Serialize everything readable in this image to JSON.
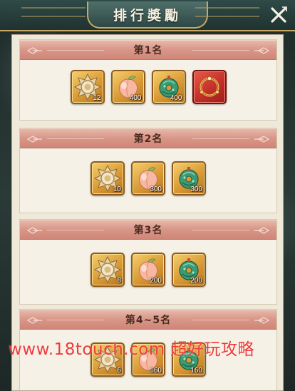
{
  "header": {
    "title": "排行奬勵"
  },
  "tiers": [
    {
      "rank_label": "第1名",
      "rewards": [
        {
          "icon": "gold-medal-icon",
          "quantity": "12"
        },
        {
          "icon": "peach-icon",
          "quantity": "400"
        },
        {
          "icon": "jade-pendant-icon",
          "quantity": "400"
        },
        {
          "icon": "ruby-ring-icon",
          "quantity": ""
        }
      ]
    },
    {
      "rank_label": "第2名",
      "rewards": [
        {
          "icon": "gold-medal-icon",
          "quantity": "10"
        },
        {
          "icon": "peach-icon",
          "quantity": "300"
        },
        {
          "icon": "jade-pendant-icon",
          "quantity": "300"
        }
      ]
    },
    {
      "rank_label": "第3名",
      "rewards": [
        {
          "icon": "gold-medal-icon",
          "quantity": "8"
        },
        {
          "icon": "peach-icon",
          "quantity": "200"
        },
        {
          "icon": "jade-pendant-icon",
          "quantity": "200"
        }
      ]
    },
    {
      "rank_label": "第4~5名",
      "rewards": [
        {
          "icon": "gold-medal-icon",
          "quantity": "6"
        },
        {
          "icon": "peach-icon",
          "quantity": "160"
        },
        {
          "icon": "jade-pendant-icon",
          "quantity": "160"
        }
      ]
    }
  ],
  "watermark": "www.18touch.com 超好玩攻略",
  "colors": {
    "header_band": "#d9988a",
    "item_gold": "#d99a35",
    "item_red": "#c3302a",
    "watermark": "#ec3b3b"
  }
}
